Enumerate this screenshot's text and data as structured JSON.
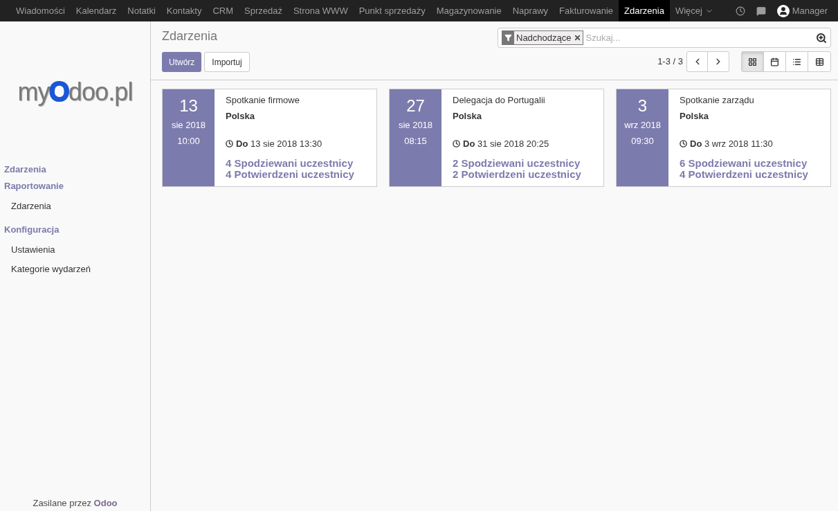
{
  "top_menu": [
    {
      "label": "Wiadomości",
      "selected": false
    },
    {
      "label": "Kalendarz",
      "selected": false
    },
    {
      "label": "Notatki",
      "selected": false
    },
    {
      "label": "Kontakty",
      "selected": false
    },
    {
      "label": "CRM",
      "selected": false
    },
    {
      "label": "Sprzedaż",
      "selected": false
    },
    {
      "label": "Strona WWW",
      "selected": false
    },
    {
      "label": "Punkt sprzedaży",
      "selected": false
    },
    {
      "label": "Magazynowanie",
      "selected": false
    },
    {
      "label": "Naprawy",
      "selected": false
    },
    {
      "label": "Fakturowanie",
      "selected": false
    },
    {
      "label": "Zdarzenia",
      "selected": true
    },
    {
      "label": "Więcej",
      "selected": false
    }
  ],
  "user": "Manager",
  "logo": {
    "before": "my",
    "accent": "O",
    "after": "doo.pl"
  },
  "sidebar": [
    {
      "label": "Zdarzenia"
    },
    {
      "label": "Raportowanie",
      "children": [
        {
          "label": "Zdarzenia"
        }
      ]
    },
    {
      "label": "Konfiguracja",
      "children": [
        {
          "label": "Ustawienia"
        },
        {
          "label": "Kategorie wydarzeń"
        }
      ]
    }
  ],
  "footer": "Zasilane przez **Odoo**",
  "title": "Zdarzenia",
  "search": {
    "facet": "Nadchodzące",
    "placeholder": "Szukaj..."
  },
  "buttons": {
    "create": "Utwórz",
    "import": "Importuj"
  },
  "pager": "1-3 / 3",
  "views": [
    {
      "kind": "kanban",
      "selected": true
    },
    {
      "kind": "calendar",
      "selected": false
    },
    {
      "kind": "list",
      "selected": false
    },
    {
      "kind": "grid",
      "selected": false
    }
  ],
  "cards": [
    {
      "day": "13",
      "month": "sie 2018",
      "time": "10:00",
      "name": "Spotkanie firmowe",
      "location": "Polska",
      "end": "**Do** 13 sie 2018 13:30",
      "expected": "4 Spodziewani uczestnicy",
      "confirmed": "4 Potwierdzeni uczestnicy"
    },
    {
      "day": "27",
      "month": "sie 2018",
      "time": "08:15",
      "name": "Delegacja do Portugalii",
      "location": "Polska",
      "end": "**Do** 31 sie 2018 20:25",
      "expected": "2 Spodziewani uczestnicy",
      "confirmed": "2 Potwierdzeni uczestnicy"
    },
    {
      "day": "3",
      "month": "wrz 2018",
      "time": "09:30",
      "name": "Spotkanie zarządu",
      "location": "Polska",
      "end": "**Do** 3 wrz 2018 11:30",
      "expected": "6 Spodziewani uczestnicy",
      "confirmed": "4 Potwierdzeni uczestnicy"
    }
  ]
}
